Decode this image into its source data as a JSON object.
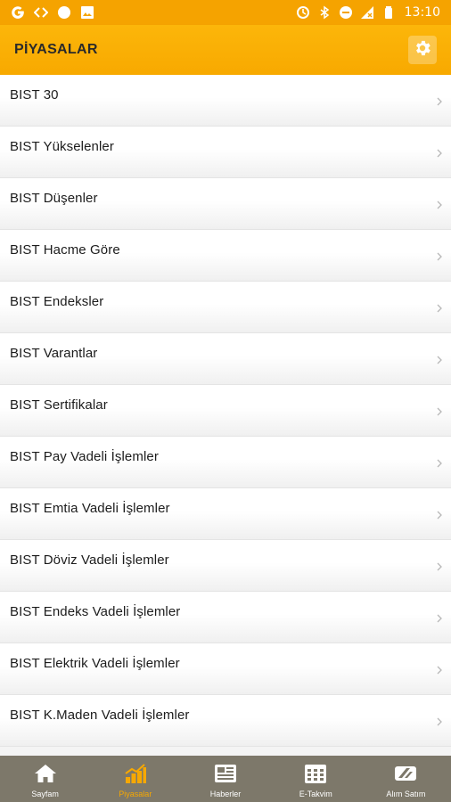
{
  "status_bar": {
    "time": "13:10",
    "left_icons": [
      "g-icon",
      "code-icon",
      "circle-icon",
      "image-icon"
    ],
    "right_icons": [
      "sync-icon",
      "bluetooth-icon",
      "dnd-icon",
      "no-signal-icon",
      "battery-icon"
    ]
  },
  "appbar": {
    "title": "PİYASALAR",
    "settings_icon": "gear-icon"
  },
  "markets": [
    {
      "label": "BIST 30"
    },
    {
      "label": "BIST Yükselenler"
    },
    {
      "label": "BIST Düşenler"
    },
    {
      "label": "BIST Hacme Göre"
    },
    {
      "label": "BIST Endeksler"
    },
    {
      "label": "BIST Varantlar"
    },
    {
      "label": "BIST Sertifikalar"
    },
    {
      "label": "BIST Pay Vadeli İşlemler"
    },
    {
      "label": "BIST Emtia Vadeli İşlemler"
    },
    {
      "label": "BIST Döviz Vadeli İşlemler"
    },
    {
      "label": "BIST Endeks Vadeli İşlemler"
    },
    {
      "label": "BIST Elektrik Vadeli İşlemler"
    },
    {
      "label": "BIST K.Maden Vadeli İşlemler"
    }
  ],
  "tabs": [
    {
      "label": "Sayfam",
      "icon": "home-icon",
      "active": false
    },
    {
      "label": "Piyasalar",
      "icon": "bar-chart-icon",
      "active": true
    },
    {
      "label": "Haberler",
      "icon": "news-icon",
      "active": false
    },
    {
      "label": "E-Takvim",
      "icon": "calendar-icon",
      "active": false
    },
    {
      "label": "Alım Satım",
      "icon": "trade-icon",
      "active": false
    }
  ],
  "colors": {
    "accent": "#f8a900",
    "tabbar": "#7d786a",
    "active_tab": "#f7a800"
  }
}
